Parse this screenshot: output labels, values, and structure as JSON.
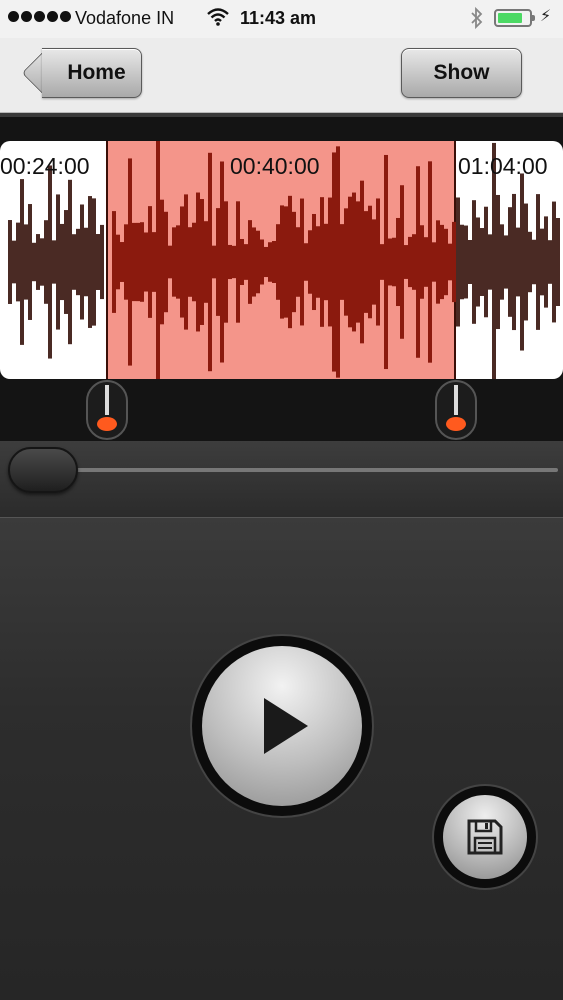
{
  "status_bar": {
    "carrier": "Vodafone IN",
    "time": "11:43 am",
    "wifi_icon": "wifi-icon",
    "bluetooth_icon": "bluetooth-icon",
    "battery_level": 0.8,
    "battery_color": "#4cd964",
    "charging_glyph": "⚡"
  },
  "nav": {
    "back_label": "Home",
    "show_label": "Show"
  },
  "waveform": {
    "time_labels": [
      "00:24:00",
      "00:40:00",
      "01:04:00"
    ],
    "selection_color": "#f4958a",
    "wave_color_selected": "#8b1a0e",
    "wave_color_unselected": "#4a2a24",
    "handle_color": "#ff5a1e"
  },
  "seek": {
    "position": 0.0
  },
  "controls": {
    "play_icon": "play-icon",
    "save_icon": "floppy-disk-icon"
  }
}
